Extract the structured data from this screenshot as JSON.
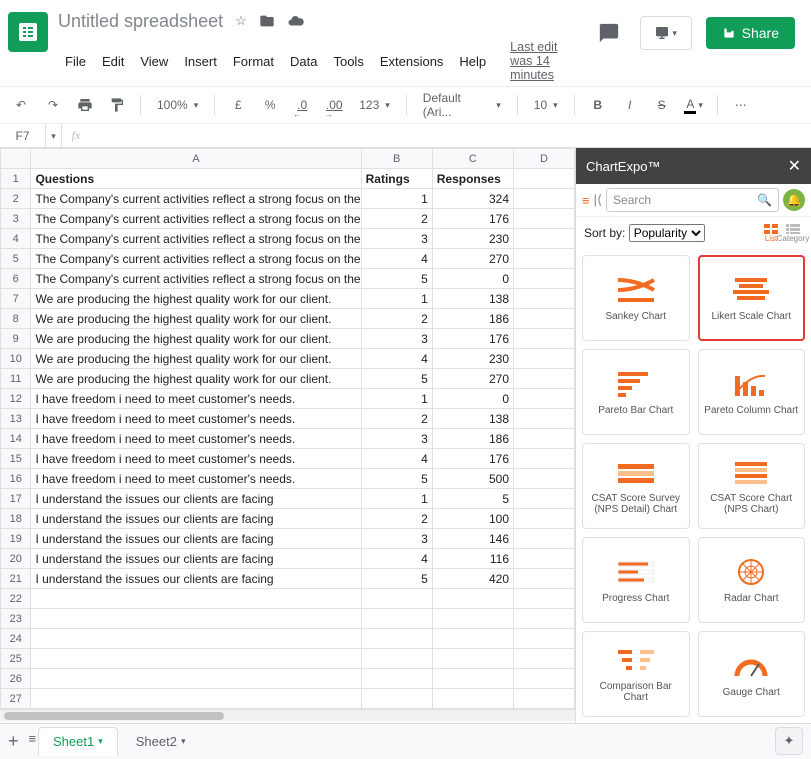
{
  "header": {
    "title": "Untitled spreadsheet",
    "menus": [
      "File",
      "Edit",
      "View",
      "Insert",
      "Format",
      "Data",
      "Tools",
      "Extensions",
      "Help"
    ],
    "last_edit": "Last edit was 14 minutes",
    "share_label": "Share"
  },
  "toolbar": {
    "zoom": "100%",
    "currency": "£",
    "percent": "%",
    "dec_dec": ".0",
    "inc_dec": ".00",
    "more_fmt": "123",
    "font": "Default (Ari...",
    "font_size": "10"
  },
  "name_box": "F7",
  "columns": [
    "A",
    "B",
    "C",
    "D"
  ],
  "headers": {
    "A": "Questions",
    "B": "Ratings",
    "C": "Responses"
  },
  "rows": [
    {
      "A": "The Company's current activities reflect a strong focus on the client.",
      "B": "1",
      "C": "324"
    },
    {
      "A": "The Company's current activities reflect a strong focus on the client.",
      "B": "2",
      "C": "176"
    },
    {
      "A": "The Company's current activities reflect a strong focus on the client.",
      "B": "3",
      "C": "230"
    },
    {
      "A": "The Company's current activities reflect a strong focus on the client.",
      "B": "4",
      "C": "270"
    },
    {
      "A": "The Company's current activities reflect a strong focus on the client.",
      "B": "5",
      "C": "0"
    },
    {
      "A": "We are producing the highest quality work for our client.",
      "B": "1",
      "C": "138"
    },
    {
      "A": "We are producing the highest quality work for our client.",
      "B": "2",
      "C": "186"
    },
    {
      "A": "We are producing the highest quality work for our client.",
      "B": "3",
      "C": "176"
    },
    {
      "A": "We are producing the highest quality work for our client.",
      "B": "4",
      "C": "230"
    },
    {
      "A": "We are producing the highest quality work for our client.",
      "B": "5",
      "C": "270"
    },
    {
      "A": "I have freedom i need to meet customer's needs.",
      "B": "1",
      "C": "0"
    },
    {
      "A": "I have freedom i need to meet customer's needs.",
      "B": "2",
      "C": "138"
    },
    {
      "A": "I have freedom i need to meet customer's needs.",
      "B": "3",
      "C": "186"
    },
    {
      "A": "I have freedom i need to meet customer's needs.",
      "B": "4",
      "C": "176"
    },
    {
      "A": "I have freedom i need to meet customer's needs.",
      "B": "5",
      "C": "500"
    },
    {
      "A": "I understand the issues our clients are facing",
      "B": "1",
      "C": "5"
    },
    {
      "A": "I understand the issues our clients are facing",
      "B": "2",
      "C": "100"
    },
    {
      "A": "I understand the issues our clients are facing",
      "B": "3",
      "C": "146"
    },
    {
      "A": "I understand the issues our clients are facing",
      "B": "4",
      "C": "116"
    },
    {
      "A": "I understand the issues our clients are facing",
      "B": "5",
      "C": "420"
    }
  ],
  "empty_rows": 6,
  "sidebar": {
    "title": "ChartExpo™",
    "search_placeholder": "Search",
    "sort_label": "Sort by:",
    "sort_value": "Popularity",
    "view_list": "List",
    "view_cat": "Category",
    "charts": [
      {
        "name": "Sankey Chart",
        "hl": false,
        "icon": "sankey"
      },
      {
        "name": "Likert Scale Chart",
        "hl": true,
        "icon": "likert"
      },
      {
        "name": "Pareto Bar Chart",
        "hl": false,
        "icon": "pbar"
      },
      {
        "name": "Pareto Column Chart",
        "hl": false,
        "icon": "pcol"
      },
      {
        "name": "CSAT Score Survey (NPS Detail) Chart",
        "hl": false,
        "icon": "csat1"
      },
      {
        "name": "CSAT Score Chart (NPS Chart)",
        "hl": false,
        "icon": "csat2"
      },
      {
        "name": "Progress Chart",
        "hl": false,
        "icon": "prog"
      },
      {
        "name": "Radar Chart",
        "hl": false,
        "icon": "radar"
      },
      {
        "name": "Comparison Bar Chart",
        "hl": false,
        "icon": "comp"
      },
      {
        "name": "Gauge Chart",
        "hl": false,
        "icon": "gauge"
      }
    ]
  },
  "tabs": {
    "sheets": [
      "Sheet1",
      "Sheet2"
    ],
    "active": 0
  }
}
